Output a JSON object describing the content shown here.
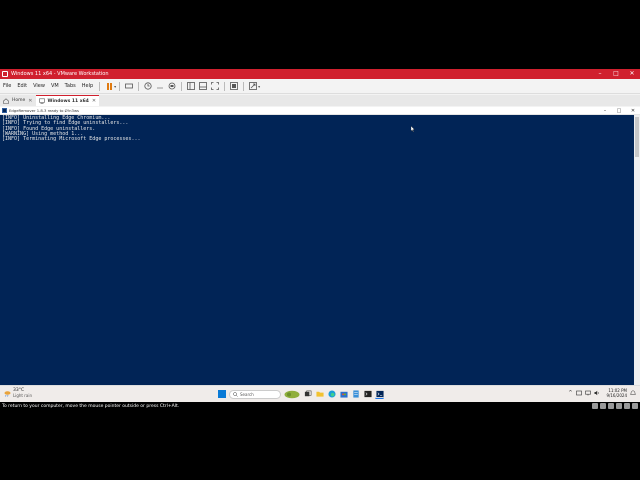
{
  "vmware": {
    "title": "Windows 11 x64 - VMware Workstation",
    "menu": [
      "File",
      "Edit",
      "View",
      "VM",
      "Tabs",
      "Help"
    ],
    "tabs": [
      {
        "label": "Home"
      },
      {
        "label": "Windows 11 x64"
      }
    ],
    "status_message": "To return to your computer, move the mouse pointer outside or press Ctrl+Alt."
  },
  "console": {
    "title": "EdgeRemover 1.8.3 ready to Ø!n3ws",
    "lines": [
      "[INFO] Uninstalling Edge Chromium...",
      "[INFO] Trying to find Edge uninstallers...",
      "[INFO] Found Edge uninstallers.",
      "[WARNING] Using method 1...",
      "[INFO] Terminating Microsoft Edge processes..."
    ]
  },
  "taskbar": {
    "weather_temp": "33°C",
    "weather_condition": "Light rain",
    "search_placeholder": "Search",
    "time": "11:02 PM",
    "date": "9/16/2024"
  },
  "colors": {
    "vmware_titlebar": "#d0202e",
    "console_bg": "#012456",
    "console_text": "#e6e6e6"
  }
}
